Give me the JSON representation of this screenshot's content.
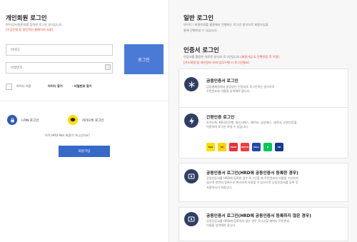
{
  "member_login": {
    "title": "개인회원 로그인",
    "desc": "아이디/비밀번호를 입력한 로그인 방식입니다.",
    "notice": "[수강신청 등 일반적인 홈페이지 사용]",
    "id_placeholder": "아이디",
    "pw_placeholder": "비밀번호",
    "login_label": "로그인",
    "save_id_label": "아이디 저장",
    "find_id_label": "아이디 찾기",
    "find_pw_label": "· 비밀번호 찾기",
    "ipin_label": "I-PIN 로그인",
    "kakao_label": "카카오톡 로그인",
    "not_member_text": "아직 HRD-Net 회원이 아니신가요?",
    "join_label": "회원가입"
  },
  "general_login": {
    "title": "일반 로그인",
    "desc_line1": "아이디 / 비밀번호를 활용해서 진행하는 로그인 방식으로 회원가입을",
    "desc_line2": "통해 진행하실 수 있습니다."
  },
  "cert_login": {
    "title": "인증서 로그인",
    "desc_a": "인증서를 활용한 새로운 방식의 로그인입니다.",
    "desc_red": "(회원가입 & 간편인증 후 이용)",
    "desc_line2": "[카드회원 및 개인정보 조회 업무수행 시 로그인필요]"
  },
  "cards": [
    {
      "title": "금융인증서 로그인",
      "line1": "금융결제원에서 발급받은 인증서로 로그인하는 방식으로",
      "line2": "주민번호와 이름을 입력해야 합니다.",
      "line3": "",
      "icon": "snowflake-icon"
    },
    {
      "title": "간편인증 로그인",
      "line1": "카카오톡, KB국민은행, 통신사패스, 페이코, 삼성패스, 네이버, 신한인증을",
      "line2": "이용하여 로그인 하실 수 있습니다.",
      "line3": "",
      "icon": "lightning-icon"
    },
    {
      "title": "공동인증서 로그인(HRD에 공동인증서 등록한 경우)",
      "line1": "공동인증서를 HRD에 등록한 경우 로그인할 때 주민번호의 이름을 수신하지",
      "line2": "않으며 한번의 등록으로 편리하게 사용할 수 있으므로 공동인증서를 등록 후",
      "line3": "사용하시기 바랍니다.",
      "icon": "certificate-icon"
    },
    {
      "title": "공동인증서 로그인(HRD에 공동인증서 등록하지 않은 경우)",
      "line1": "공동인증서를 HRD에 등록하지 않은 경우 로그인할 때마다 주민번호,",
      "line2": "이름을 입력해야 합니다.",
      "line3": "",
      "icon": "certificate-lock-icon"
    }
  ],
  "apps": [
    {
      "name": "kakao",
      "label": "Talk",
      "color": "#f9e000",
      "text_color": "#3b1e1e"
    },
    {
      "name": "kb",
      "label": "KB",
      "color": "#ffd100",
      "text_color": "#5a4a00"
    },
    {
      "name": "pass",
      "label": "PASS",
      "color": "#e8303a",
      "text_color": "#ffffff"
    },
    {
      "name": "payco",
      "label": "PAYCO",
      "color": "#f03c3c",
      "text_color": "#ffffff"
    },
    {
      "name": "samsung",
      "label": "Pass",
      "color": "#1f4aa8",
      "text_color": "#ffffff"
    },
    {
      "name": "naver",
      "label": "N",
      "color": "#03c75a",
      "text_color": "#ffffff"
    },
    {
      "name": "shinhan",
      "label": "SH",
      "color": "#143b8c",
      "text_color": "#ffffff"
    }
  ],
  "colors": {
    "accent": "#4a7ad6",
    "join": "#3869c9",
    "red": "#e2442f",
    "icon_bg": "#2f3f63"
  }
}
